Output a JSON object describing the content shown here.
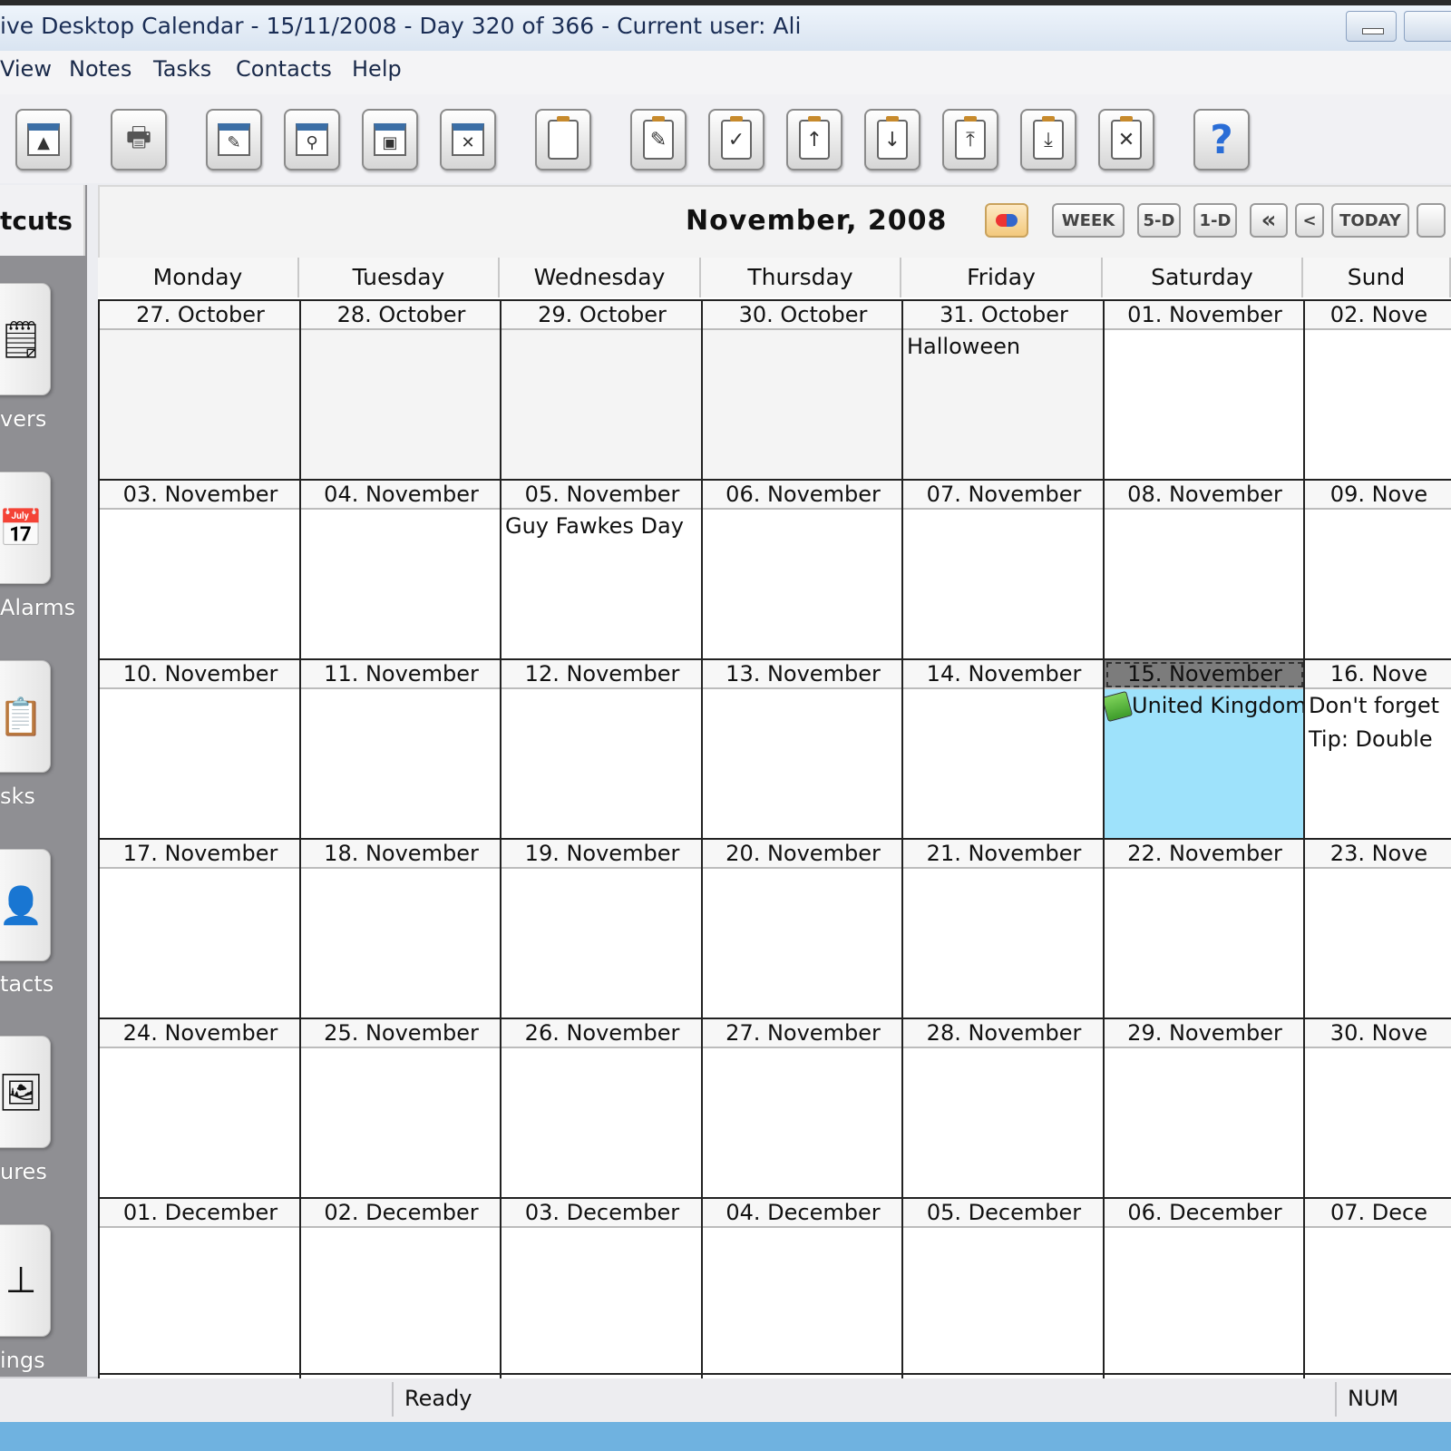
{
  "window": {
    "title": "ive Desktop Calendar - 15/11/2008 - Day 320 of 366 - Current user: Ali"
  },
  "menu": [
    "View",
    "Notes",
    "Tasks",
    "Contacts",
    "Help"
  ],
  "toolbar": {
    "icons": [
      "alarm-window-icon",
      "printer-icon",
      "search-window-icon",
      "find-window-icon",
      "picture-window-icon",
      "delete-window-icon",
      "note-icon",
      "edit-task-icon",
      "complete-task-icon",
      "move-up-icon",
      "move-down-icon",
      "move-top-icon",
      "move-bottom-icon",
      "delete-task-icon",
      "help-icon"
    ],
    "help_glyph": "?"
  },
  "sidebar": {
    "title": "tcuts",
    "items": [
      {
        "label": "vers",
        "icon": "sticky-notes-icon"
      },
      {
        "label": "Alarms",
        "icon": "calendar-alarm-icon"
      },
      {
        "label": "sks",
        "icon": "tasks-clipboard-icon"
      },
      {
        "label": "tacts",
        "icon": "contacts-icon"
      },
      {
        "label": "ures",
        "icon": "pictures-icon"
      },
      {
        "label": "ings",
        "icon": "settings-slider-icon"
      }
    ]
  },
  "calendar": {
    "month_title": "November, 2008",
    "nav": {
      "week": "WEEK",
      "five_day": "5-D",
      "one_day": "1-D",
      "prev_fast": "«",
      "prev": "<",
      "today": "TODAY"
    },
    "weekdays": [
      "Monday",
      "Tuesday",
      "Wednesday",
      "Thursday",
      "Friday",
      "Saturday",
      "Sund"
    ],
    "weeks": [
      [
        {
          "date": "27. October",
          "other": true,
          "events": []
        },
        {
          "date": "28. October",
          "other": true,
          "events": []
        },
        {
          "date": "29. October",
          "other": true,
          "events": []
        },
        {
          "date": "30. October",
          "other": true,
          "events": []
        },
        {
          "date": "31. October",
          "other": true,
          "events": [
            "Halloween"
          ]
        },
        {
          "date": "01. November",
          "events": []
        },
        {
          "date": "02. Nove",
          "events": []
        }
      ],
      [
        {
          "date": "03. November",
          "events": []
        },
        {
          "date": "04. November",
          "events": []
        },
        {
          "date": "05. November",
          "events": [
            "Guy Fawkes Day"
          ]
        },
        {
          "date": "06. November",
          "events": []
        },
        {
          "date": "07. November",
          "events": []
        },
        {
          "date": "08. November",
          "events": []
        },
        {
          "date": "09. Nove",
          "events": []
        }
      ],
      [
        {
          "date": "10. November",
          "events": []
        },
        {
          "date": "11. November",
          "events": []
        },
        {
          "date": "12. November",
          "events": []
        },
        {
          "date": "13. November",
          "events": []
        },
        {
          "date": "14. November",
          "events": []
        },
        {
          "date": "15. November",
          "today": true,
          "events": [
            "United Kingdom"
          ]
        },
        {
          "date": "16. Nove",
          "events": [
            "Don't forget",
            "Tip: Double"
          ]
        }
      ],
      [
        {
          "date": "17. November",
          "events": []
        },
        {
          "date": "18. November",
          "events": []
        },
        {
          "date": "19. November",
          "events": []
        },
        {
          "date": "20. November",
          "events": []
        },
        {
          "date": "21. November",
          "events": []
        },
        {
          "date": "22. November",
          "events": []
        },
        {
          "date": "23. Nove",
          "events": []
        }
      ],
      [
        {
          "date": "24. November",
          "events": []
        },
        {
          "date": "25. November",
          "events": []
        },
        {
          "date": "26. November",
          "events": []
        },
        {
          "date": "27. November",
          "events": []
        },
        {
          "date": "28. November",
          "events": []
        },
        {
          "date": "29. November",
          "events": []
        },
        {
          "date": "30. Nove",
          "events": []
        }
      ],
      [
        {
          "date": "01. December",
          "events": []
        },
        {
          "date": "02. December",
          "events": []
        },
        {
          "date": "03. December",
          "events": []
        },
        {
          "date": "04. December",
          "events": []
        },
        {
          "date": "05. December",
          "events": []
        },
        {
          "date": "06. December",
          "events": []
        },
        {
          "date": "07. Dece",
          "events": []
        }
      ]
    ]
  },
  "status": {
    "text": "Ready",
    "num": "NUM"
  },
  "colors": {
    "today_fill": "#9ee2fb",
    "title_text": "#1a2d55",
    "sidebar_bg": "#8f8f93"
  }
}
